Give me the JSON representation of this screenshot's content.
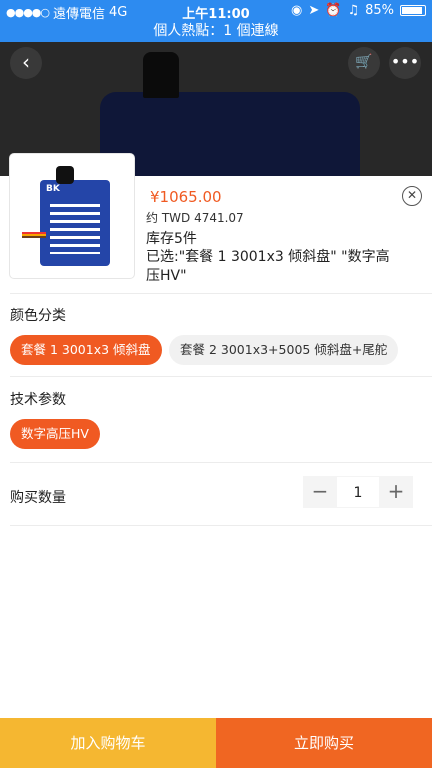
{
  "status_bar": {
    "carrier": "遠傳電信",
    "network": "4G",
    "time": "上午11:00",
    "battery": "85%"
  },
  "hotspot": {
    "text": "個人熱點：1 個連線"
  },
  "product": {
    "price": "¥1065.00",
    "price_twd": "约 TWD 4741.07",
    "stock": "库存5件",
    "selected": "已选:\"套餐 1 3001x3 倾斜盘\" \"数字高压HV\"",
    "thumb_label": "BK"
  },
  "options": {
    "color": {
      "title": "颜色分类",
      "choices": [
        "套餐 1 3001x3 倾斜盘",
        "套餐 2 3001x3+5005 倾斜盘+尾舵"
      ]
    },
    "tech": {
      "title": "技术参数",
      "choices": [
        "数字高压HV"
      ]
    }
  },
  "quantity": {
    "label": "购买数量",
    "value": "1",
    "minus": "−",
    "plus": "+"
  },
  "actions": {
    "add_to_cart": "加入购物车",
    "buy_now": "立即购买"
  },
  "colors": {
    "brand_blue": "#2d8bf0",
    "accent_orange": "#f05a22",
    "cart_yellow": "#f5b731",
    "buy_orange": "#f06622"
  }
}
